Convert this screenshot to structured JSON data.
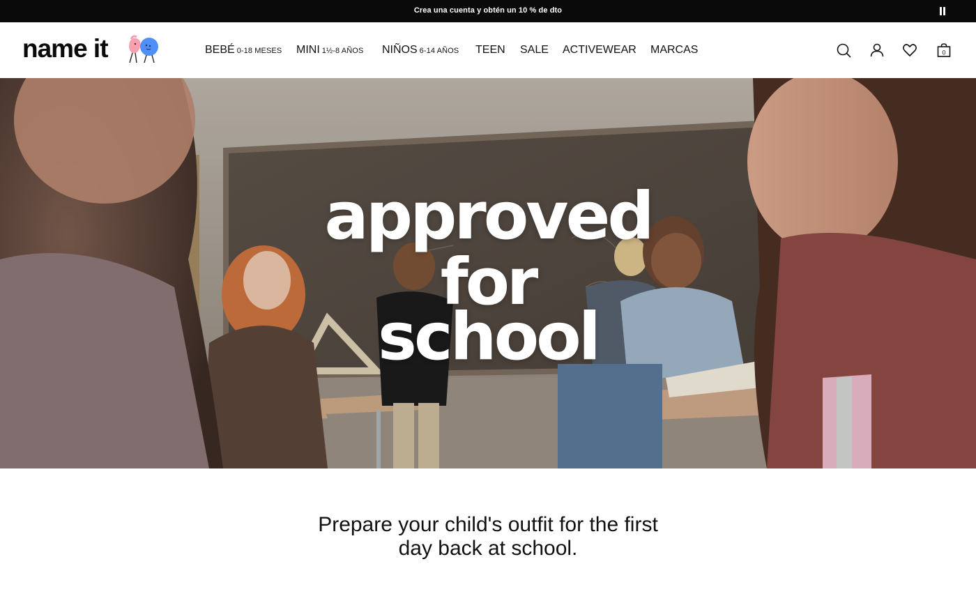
{
  "promo": {
    "text": "Crea una cuenta y obtén un 10 % de dto",
    "pause_icon": "pause-icon"
  },
  "header": {
    "logo_text": "name it",
    "nav": [
      {
        "label": "BEBÉ",
        "sub": "0-18 MESES"
      },
      {
        "label": "MINI",
        "sub": "1½-8 AÑOS"
      },
      {
        "label": "NIÑOS",
        "sub": "6-14 AÑOS"
      },
      {
        "label": "TEEN",
        "sub": ""
      },
      {
        "label": "SALE",
        "sub": ""
      },
      {
        "label": "ACTIVEWEAR",
        "sub": ""
      },
      {
        "label": "MARCAS",
        "sub": ""
      }
    ],
    "icons": [
      "search-icon",
      "account-icon",
      "heart-icon",
      "bag-icon"
    ],
    "bag_count": "0"
  },
  "hero": {
    "line1": "approved",
    "line2": "for",
    "line3": "school"
  },
  "intro": {
    "line1": "Prepare your child's outfit for the first",
    "line2": "day back at school."
  },
  "colors": {
    "promo_bg": "#0a0a0a",
    "logo_pink": "#f6a0b0",
    "logo_blue": "#4f8ff7",
    "text": "#111111"
  }
}
